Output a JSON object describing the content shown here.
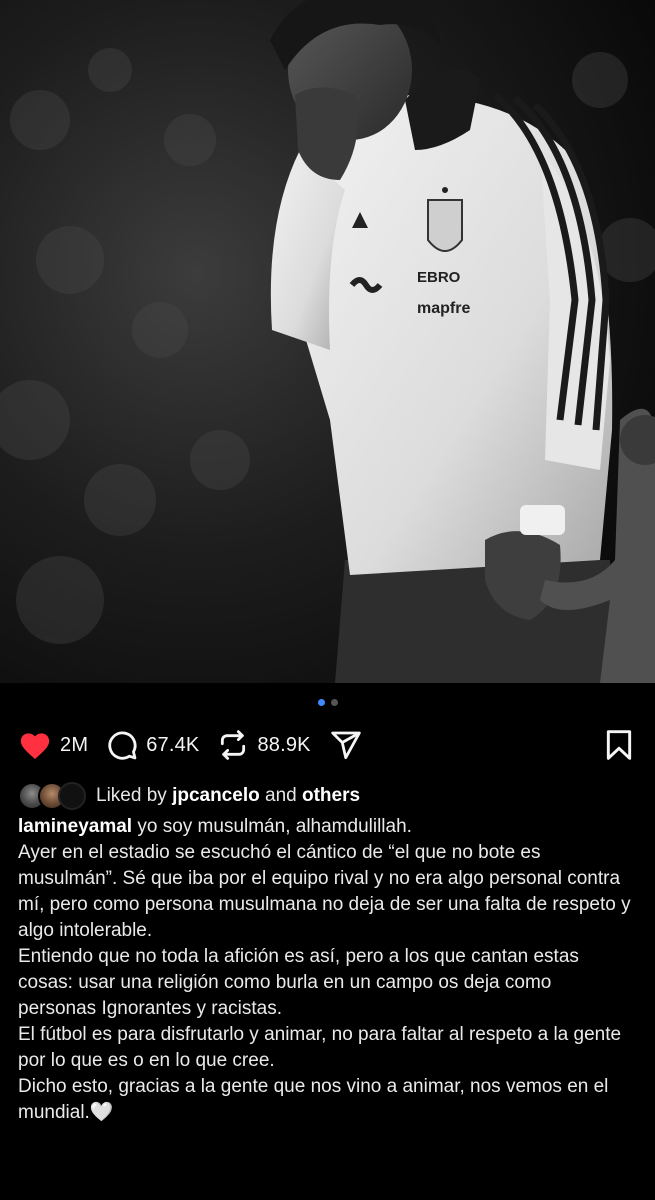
{
  "carousel": {
    "total": 2,
    "active": 0
  },
  "actions": {
    "likes": "2M",
    "comments": "67.4K",
    "reposts": "88.9K"
  },
  "liked_by": {
    "prefix": "Liked by",
    "user": "jpcancelo",
    "and": "and",
    "others": "others"
  },
  "caption": {
    "username": "lamineyamal",
    "first_line": "yo soy musulmán, alhamdulillah.",
    "paragraphs": [
      "Ayer en el estadio se escuchó el cántico de “el que no bote es musulmán”. Sé que iba por el equipo rival y no era algo personal contra mí, pero como persona musulmana no deja de ser una falta de respeto y algo intolerable.",
      "Entiendo que no toda la afición es así, pero a los que cantan estas cosas: usar una religión como burla en un campo os deja como personas Ignorantes y racistas.",
      "El fútbol es para disfrutarlo y animar, no para faltar al respeto a la gente por lo que es o en lo que cree.",
      "Dicho esto, gracias a la gente que nos vino a animar, nos vemos en el mundial.🤍"
    ]
  },
  "jacket_text": {
    "sponsor_top": "EBRO",
    "sponsor_bottom": "mapfre"
  },
  "colors": {
    "like": "#ff3040",
    "accent_dot": "#3d8bff",
    "background": "#000000"
  }
}
